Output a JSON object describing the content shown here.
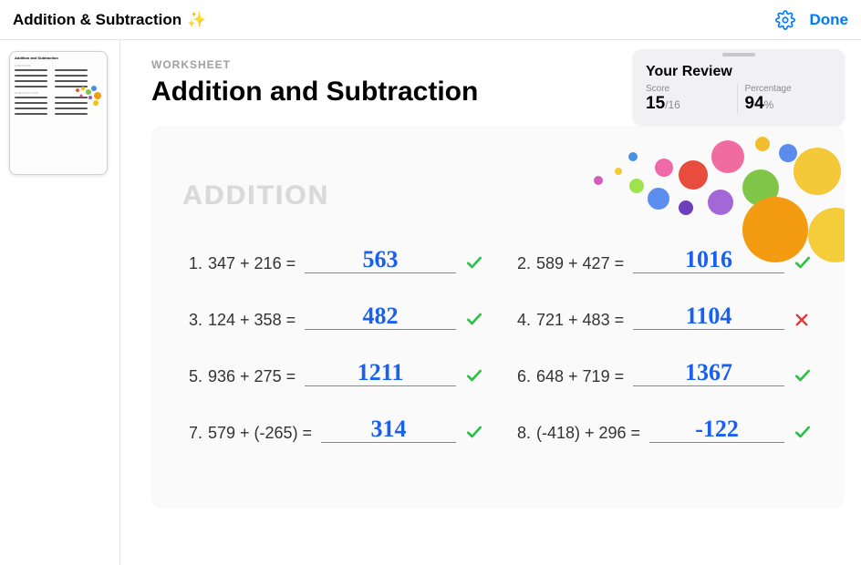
{
  "topbar": {
    "title": "Addition & Subtraction",
    "sparkle": "✨",
    "done": "Done"
  },
  "page": {
    "kicker": "WORKSHEET",
    "title": "Addition and Subtraction"
  },
  "review": {
    "title": "Your Review",
    "score_label": "Score",
    "score_num": "15",
    "score_den": "16",
    "pct_label": "Percentage",
    "pct_num": "94",
    "pct_sym": "%"
  },
  "worksheet": {
    "section_title": "ADDITION",
    "problems": [
      {
        "n": "1.",
        "expr": "347 + 216 =",
        "answer": "563",
        "correct": true
      },
      {
        "n": "2.",
        "expr": "589 + 427 =",
        "answer": "1016",
        "correct": true
      },
      {
        "n": "3.",
        "expr": "124 + 358 =",
        "answer": "482",
        "correct": true
      },
      {
        "n": "4.",
        "expr": "721 + 483 =",
        "answer": "1104",
        "correct": false
      },
      {
        "n": "5.",
        "expr": "936 + 275 =",
        "answer": "1211",
        "correct": true
      },
      {
        "n": "6.",
        "expr": "648 + 719 =",
        "answer": "1367",
        "correct": true
      },
      {
        "n": "7.",
        "expr": "579 + (-265) =",
        "answer": "314",
        "correct": true
      },
      {
        "n": "8.",
        "expr": "(-418) + 296 =",
        "answer": "-122",
        "correct": true
      }
    ]
  },
  "thumb": {
    "title": "Addition and Subtraction",
    "section1": "ADDITION",
    "section2": "SUBTRACTION"
  }
}
